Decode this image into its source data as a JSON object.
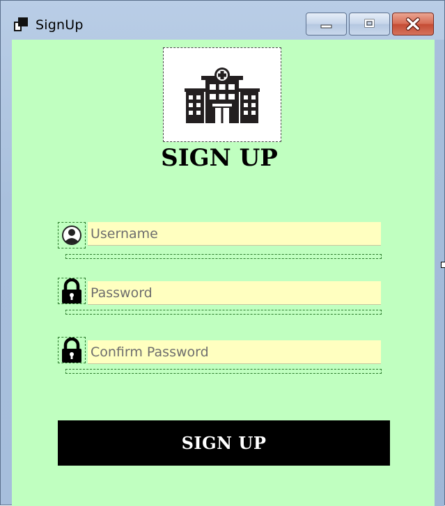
{
  "window": {
    "title": "SignUp"
  },
  "icons": {
    "app": "window-app-icon",
    "logo": "hospital-icon",
    "username": "user-circle-icon",
    "password": "lock-icon",
    "confirm_password": "lock-icon"
  },
  "heading": "SIGN UP",
  "form": {
    "username": {
      "value": "",
      "placeholder": "Username"
    },
    "password": {
      "value": "",
      "placeholder": "Password"
    },
    "confirm_password": {
      "value": "",
      "placeholder": "Confirm Password"
    }
  },
  "signup_button_label": "SIGN UP",
  "colors": {
    "background": "#c0ffc0",
    "input_background": "#ffffc0",
    "button_background": "#000000",
    "button_text": "#ffffff",
    "close_button": "#c44b33"
  }
}
